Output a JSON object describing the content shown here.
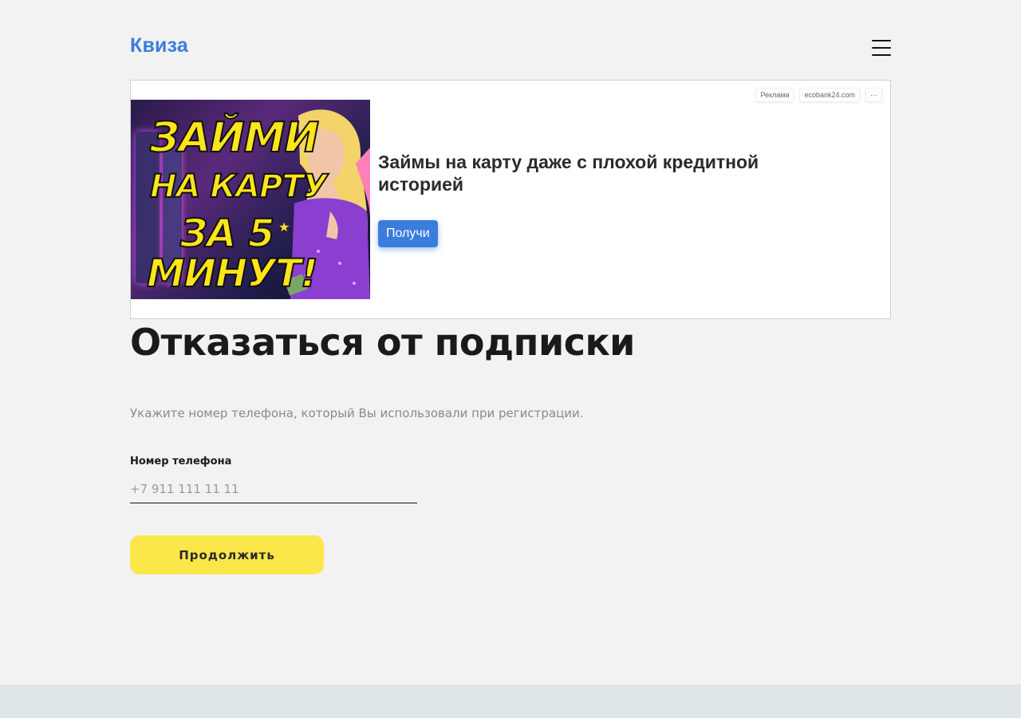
{
  "header": {
    "logo": "Квиза",
    "menu_icon": "hamburger-menu-icon"
  },
  "ad": {
    "label": "Реклама",
    "domain": "ecobank24.com",
    "more": "···",
    "image_text": [
      "ЗАЙМИ",
      "НА КАРТУ",
      "ЗА 5",
      "МИНУТ!"
    ],
    "title": "Займы на карту даже с плохой кредитной историей",
    "button": "Получи"
  },
  "main": {
    "title": "Отказаться от подписки",
    "hint": "Укажите номер телефона, который Вы использовали при регистрации.",
    "phone_label": "Номер телефона",
    "phone_placeholder": "+7 911 111 11 11",
    "phone_value": "",
    "submit": "Продолжить"
  },
  "colors": {
    "brand": "#3b7ddd",
    "button": "#fce74b",
    "background": "#f2f2f2",
    "footer": "#dfe6e9"
  }
}
